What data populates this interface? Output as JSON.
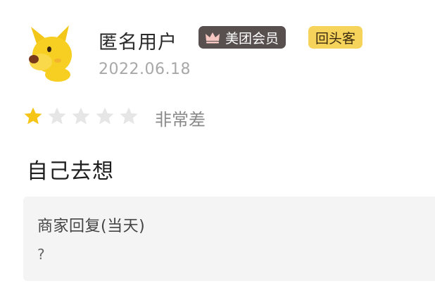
{
  "review": {
    "username": "匿名用户",
    "member_badge": "美团会员",
    "repeat_badge": "回头客",
    "date": "2022.06.18",
    "rating": 1,
    "rating_max": 5,
    "rating_text": "非常差",
    "content": "自己去想"
  },
  "merchant_reply": {
    "title": "商家回复(当天)",
    "content": "?"
  },
  "colors": {
    "star_filled": "#f5c518",
    "star_empty": "#e6e6e6",
    "member_badge_bg": "#58504f",
    "repeat_badge_bg": "#f6d35a"
  },
  "icons": {
    "avatar": "yellow-dog-avatar",
    "member_badge": "crown-icon",
    "rating": "star-icon"
  }
}
